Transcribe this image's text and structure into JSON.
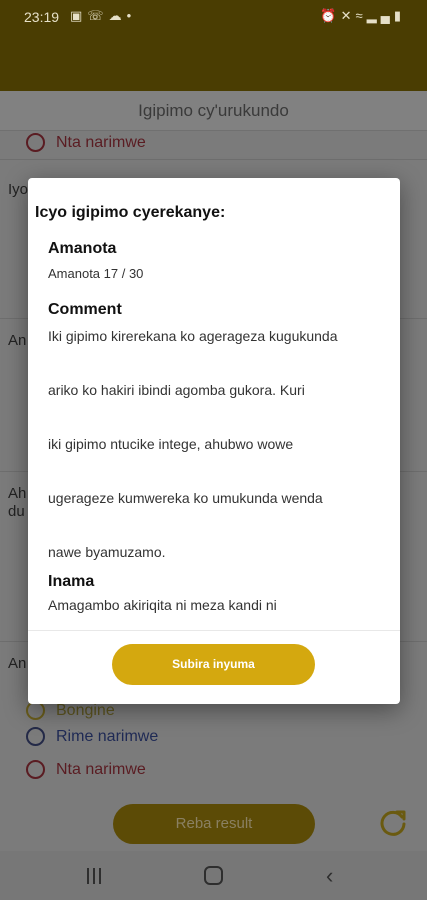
{
  "status_bar": {
    "time": "23:19",
    "left_icons": [
      "image-icon",
      "whatsapp-icon",
      "cloud-icon",
      "dot-icon"
    ],
    "right_icons": [
      "alarm-icon",
      "mute-icon",
      "wifi-icon",
      "signal-icon",
      "battery-icon"
    ]
  },
  "header": {
    "title": "Igipimo cy'urukundo"
  },
  "background": {
    "top_option": "Nta narimwe",
    "q1_fragment": "Iyo",
    "q2_fragment": "An",
    "q3_fragment_line1": "Ah",
    "q3_fragment_line2": "du",
    "q4_fragment": "An",
    "options": [
      "Bongine",
      "Rime narimwe",
      "Nta narimwe"
    ],
    "result_button": "Reba result",
    "refresh_icon": "refresh-icon"
  },
  "dialog": {
    "title": "Icyo igipimo cyerekanye:",
    "amanota_heading": "Amanota",
    "amanota_value": "Amanota 17 / 30",
    "comment_heading": "Comment",
    "comment_lines": [
      "Iki gipimo kirerekana ko agerageza kugukunda",
      "ariko ko hakiri ibindi agomba gukora. Kuri",
      "iki gipimo ntucike intege, ahubwo wowe",
      "ugerageze kumwereka ko umukunda wenda",
      "nawe byamuzamo."
    ],
    "inama_heading": "Inama",
    "inama_line": "Amagambo akiriqita ni meza kandi ni",
    "back_button": "Subira inyuma"
  },
  "colors": {
    "accent": "#d4a80f",
    "header_dark": "#4a3d02",
    "option_red": "#c0392b",
    "option_blue": "#1e3a8a"
  }
}
